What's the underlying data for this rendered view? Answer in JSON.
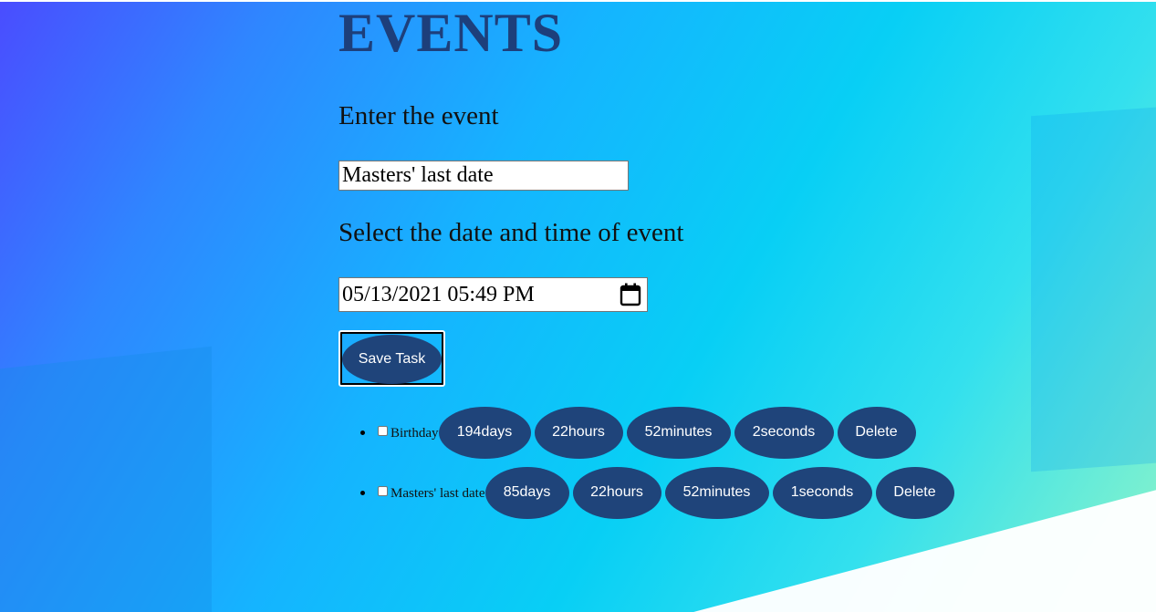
{
  "page": {
    "title": "EVENTS",
    "event_label": "Enter the event",
    "event_value": "Masters' last date",
    "date_label": "Select the date and time of event",
    "date_value": "05/13/2021 05:49 PM",
    "save_label": "Save Task"
  },
  "events": [
    {
      "name": "Birthday",
      "checked": false,
      "days": "194days",
      "hours": "22hours",
      "minutes": "52minutes",
      "seconds": "2seconds",
      "delete_label": "Delete"
    },
    {
      "name": "Masters' last date",
      "checked": false,
      "days": "85days",
      "hours": "22hours",
      "minutes": "52minutes",
      "seconds": "1seconds",
      "delete_label": "Delete"
    }
  ],
  "colors": {
    "title": "#1d3f7b",
    "button": "#1f447a",
    "button_text": "#ffffff"
  },
  "icons": {
    "calendar": "calendar-icon"
  }
}
